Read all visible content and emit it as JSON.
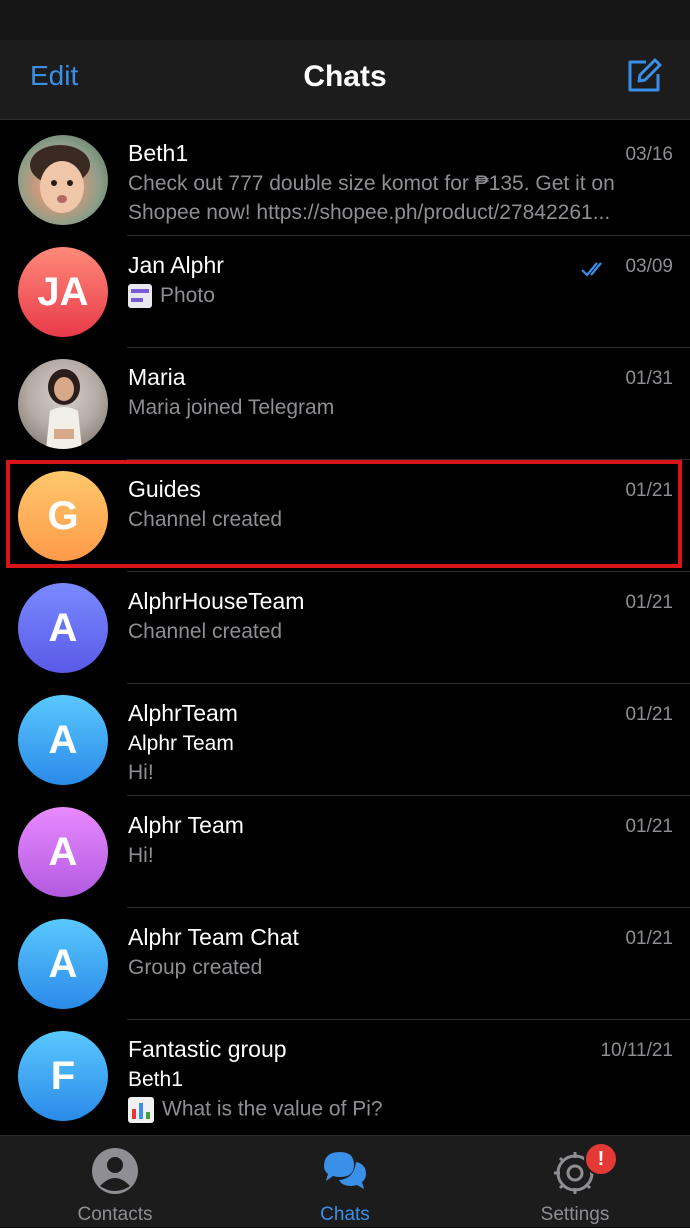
{
  "header": {
    "edit_label": "Edit",
    "title": "Chats"
  },
  "chats": [
    {
      "name": "Beth1",
      "date": "03/16",
      "line1": "Check out 777 double size komot for ₱135. Get it on",
      "line2": "Shopee now! https://shopee.ph/product/27842261..."
    },
    {
      "name": "Jan Alphr",
      "date": "03/09",
      "line1": "Photo",
      "initials": "JA",
      "status": "read"
    },
    {
      "name": "Maria",
      "date": "01/31",
      "line1": "Maria joined Telegram"
    },
    {
      "name": "Guides",
      "date": "01/21",
      "line1": "Channel created",
      "initials": "G"
    },
    {
      "name": "AlphrHouseTeam",
      "date": "01/21",
      "line1": "Channel created",
      "initials": "A"
    },
    {
      "name": "AlphrTeam",
      "date": "01/21",
      "line1": "Alphr Team",
      "line2": "Hi!",
      "initials": "A"
    },
    {
      "name": "Alphr Team",
      "date": "01/21",
      "line1": "Hi!",
      "initials": "A"
    },
    {
      "name": "Alphr Team Chat",
      "date": "01/21",
      "line1": "Group created",
      "initials": "A"
    },
    {
      "name": "Fantastic group",
      "date": "10/11/21",
      "line1": "Beth1",
      "line2": "What is the value of Pi?",
      "initials": "F"
    }
  ],
  "tabs": {
    "contacts_label": "Contacts",
    "chats_label": "Chats",
    "settings_label": "Settings",
    "settings_badge": "!"
  },
  "colors": {
    "accent": "#3a8fe8",
    "highlight": "#d9141a",
    "badge": "#e53935"
  }
}
